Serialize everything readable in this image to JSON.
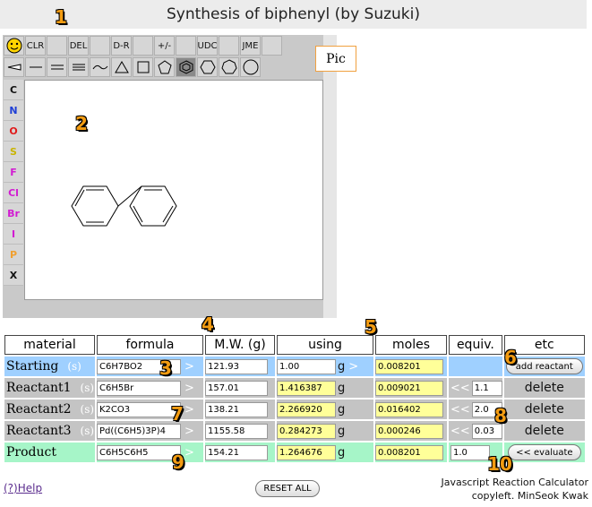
{
  "title": "Synthesis of biphenyl (by Suzuki)",
  "badges": [
    "1",
    "2",
    "3",
    "4",
    "5",
    "6",
    "7",
    "8",
    "9",
    "10"
  ],
  "toolbar": {
    "row1": [
      "",
      "CLR",
      "",
      "DEL",
      "",
      "D-R",
      "",
      "+/-",
      "",
      "UDC",
      "",
      "JME",
      ""
    ],
    "row2_icons": [
      "wedge-icon",
      "single-bond-icon",
      "double-bond-icon",
      "triple-bond-icon",
      "chain-icon",
      "triangle-icon",
      "square-icon",
      "pentagon-icon",
      "benzene-icon",
      "hexagon-icon",
      "heptagon-icon",
      "octagon-icon"
    ]
  },
  "atoms": [
    {
      "label": "C",
      "color": "#111111"
    },
    {
      "label": "N",
      "color": "#1f3fd6"
    },
    {
      "label": "O",
      "color": "#e01b1b"
    },
    {
      "label": "S",
      "color": "#c9b400"
    },
    {
      "label": "F",
      "color": "#d21bd2"
    },
    {
      "label": "Cl",
      "color": "#d21bd2"
    },
    {
      "label": "Br",
      "color": "#d21bd2"
    },
    {
      "label": "I",
      "color": "#d21bd2"
    },
    {
      "label": "P",
      "color": "#f0a030"
    },
    {
      "label": "X",
      "color": "#111111"
    }
  ],
  "pic_label": "Pic",
  "headers": [
    "material",
    "formula",
    "M.W. (g)",
    "using",
    "moles",
    "equiv.",
    "etc"
  ],
  "rows": [
    {
      "name": "Starting",
      "s": "(s)",
      "formula": "C6H7BO2",
      "mw": "121.93",
      "using": "1.00",
      "unit": "g",
      "moles": "0.008201",
      "equiv": "",
      "etc": "add reactant",
      "type": "start"
    },
    {
      "name": "Reactant1",
      "s": "(s)",
      "formula": "C6H5Br",
      "mw": "157.01",
      "using": "1.416387",
      "unit": "g",
      "moles": "0.009021",
      "equiv": "1.1",
      "etc": "delete",
      "type": "re"
    },
    {
      "name": "Reactant2",
      "s": "(s)",
      "formula": "K2CO3",
      "mw": "138.21",
      "using": "2.266920",
      "unit": "g",
      "moles": "0.016402",
      "equiv": "2.0",
      "etc": "delete",
      "type": "re"
    },
    {
      "name": "Reactant3",
      "s": "(s)",
      "formula": "Pd((C6H5)3P)4",
      "mw": "1155.58",
      "using": "0.284273",
      "unit": "g",
      "moles": "0.000246",
      "equiv": "0.03",
      "etc": "delete",
      "type": "re"
    },
    {
      "name": "Product",
      "s": "",
      "formula": "C6H5C6H5",
      "mw": "154.21",
      "using": "1.264676",
      "unit": "g",
      "moles": "0.008201",
      "equiv": "1.0",
      "etc": "<< evaluate",
      "type": "prod"
    }
  ],
  "footer": {
    "help": "(?)Help",
    "reset": "RESET ALL",
    "credit1": "Javascript Reaction Calculator",
    "credit2": "copyleft. MinSeok Kwak"
  }
}
